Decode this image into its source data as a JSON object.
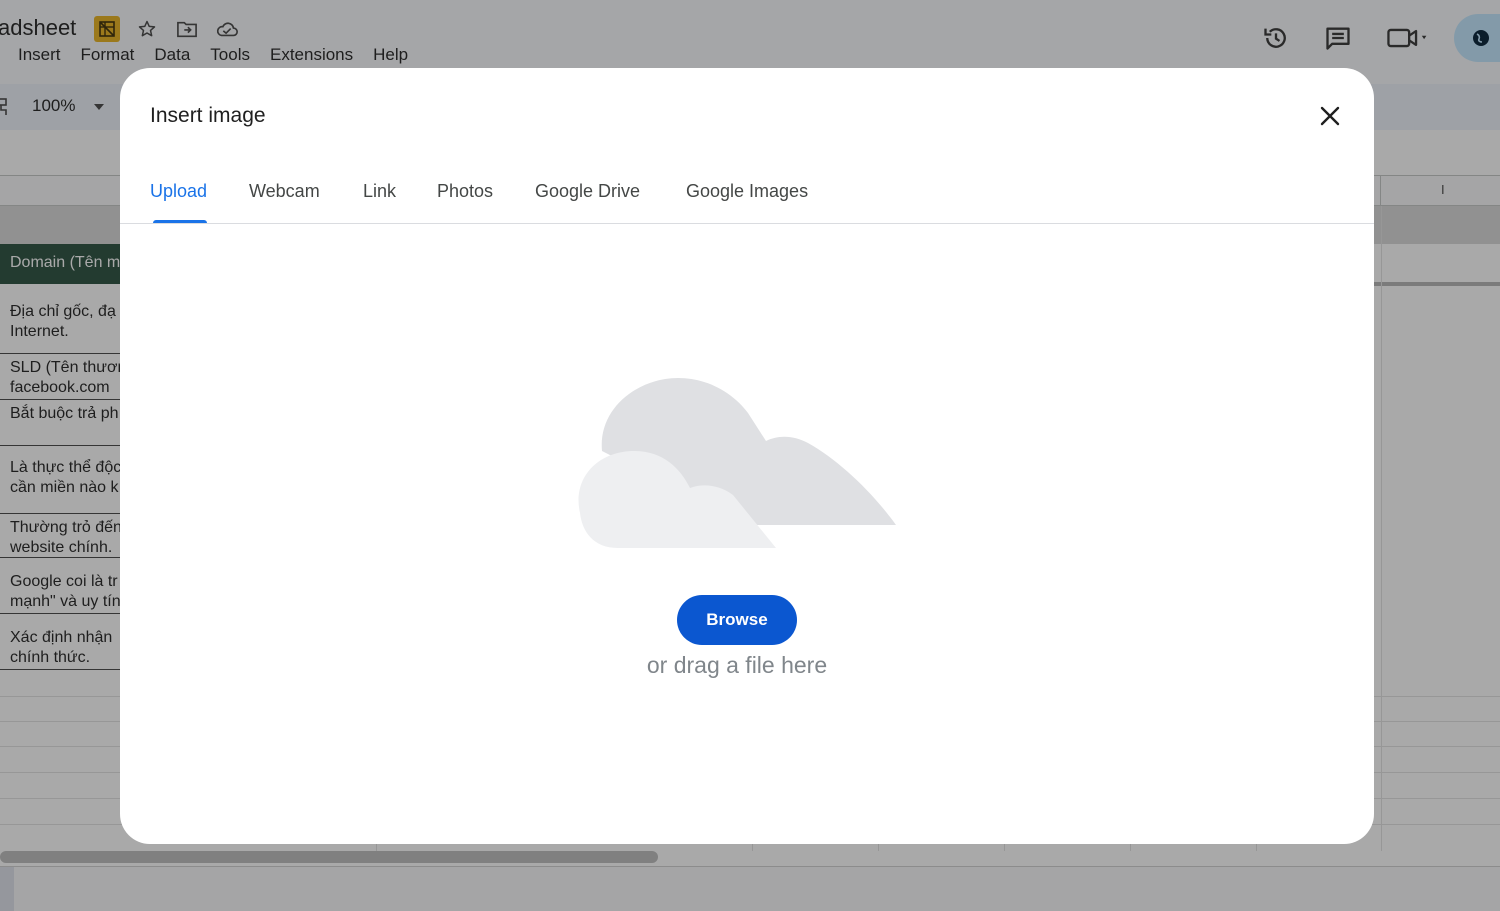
{
  "window": {
    "doc_title": "adsheet",
    "menu": [
      "",
      "Insert",
      "Format",
      "Data",
      "Tools",
      "Extensions",
      "Help"
    ]
  },
  "toolbar": {
    "zoom": "100%"
  },
  "sheet": {
    "column_letter": "I",
    "header_cell": "Domain (Tên m",
    "rows": [
      [
        "Địa chỉ gốc, đạ",
        "Internet."
      ],
      [
        "SLD (Tên thươn",
        "facebook.com"
      ],
      [
        "Bắt buộc trả ph",
        ""
      ],
      [
        "Là thực thể độc",
        "cần miền nào k"
      ],
      [
        "Thường trỏ đến",
        "website chính."
      ],
      [
        "Google coi là tr",
        "mạnh\" và uy tín"
      ],
      [
        "Xác định nhận",
        "chính thức."
      ]
    ]
  },
  "dialog": {
    "title": "Insert image",
    "tabs": [
      "Upload",
      "Webcam",
      "Link",
      "Photos",
      "Google Drive",
      "Google Images"
    ],
    "active_tab": "Upload",
    "browse_label": "Browse",
    "drag_text": "or drag a file here",
    "accent_color": "#1a73e8",
    "button_color": "#0b57d0"
  }
}
